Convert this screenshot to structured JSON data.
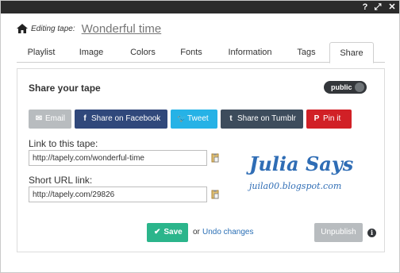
{
  "titlebar": {
    "help_glyph": "?",
    "expand_glyph": "⤢",
    "close_glyph": "✕"
  },
  "editing": {
    "label": "Editing tape:",
    "title": "Wonderful time"
  },
  "tabs": [
    {
      "label": "Playlist",
      "active": false
    },
    {
      "label": "Image",
      "active": false
    },
    {
      "label": "Colors",
      "active": false
    },
    {
      "label": "Fonts",
      "active": false
    },
    {
      "label": "Information",
      "active": false
    },
    {
      "label": "Tags",
      "active": false
    },
    {
      "label": "Share",
      "active": true
    }
  ],
  "share": {
    "title": "Share your tape",
    "public_label": "public",
    "buttons": {
      "email": {
        "glyph": "✉",
        "label": "Email",
        "color": "#b8bcbf"
      },
      "facebook": {
        "glyph": "f",
        "label": "Share on Facebook",
        "color": "#30487b"
      },
      "tweet": {
        "glyph": "🐦",
        "label": "Tweet",
        "color": "#26b2e6"
      },
      "tumblr": {
        "glyph": "t",
        "label": "Share on Tumblr",
        "color": "#3d4c5c"
      },
      "pinit": {
        "glyph": "P",
        "label": "Pin it",
        "color": "#d12026"
      }
    },
    "link_label": "Link to this tape:",
    "link_value": "http://tapely.com/wonderful-time",
    "short_label": "Short URL link:",
    "short_value": "http://tapely.com/29826"
  },
  "watermark": {
    "title": "Julia Says",
    "url": "juila00.blogspot.com"
  },
  "actions": {
    "save_glyph": "✔",
    "save_label": "Save",
    "or_text": "or",
    "undo_label": "Undo changes",
    "unpublish_label": "Unpublish",
    "info_glyph": "i"
  },
  "colors": {
    "save_green": "#2bb58b",
    "link_blue": "#2a6fb5",
    "titlebar": "#2b2b2b"
  }
}
